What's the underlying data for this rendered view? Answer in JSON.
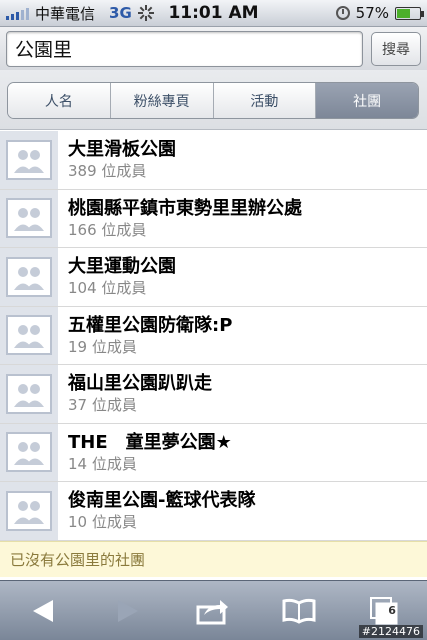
{
  "status_bar": {
    "carrier": "中華電信",
    "network": "3G",
    "time": "11:01 AM",
    "battery_percent": "57%",
    "battery_level": 0.57
  },
  "search": {
    "value": "公園里",
    "button_label": "搜尋"
  },
  "tabs": [
    {
      "label": "人名",
      "active": false
    },
    {
      "label": "粉絲專頁",
      "active": false
    },
    {
      "label": "活動",
      "active": false
    },
    {
      "label": "社團",
      "active": true
    }
  ],
  "results": [
    {
      "name": "大里滑板公園",
      "members": "389 位成員"
    },
    {
      "name": "桃園縣平鎮市東勢里里辦公處",
      "members": "166 位成員"
    },
    {
      "name": "大里運動公園",
      "members": "104 位成員"
    },
    {
      "name": "五權里公園防衛隊:P",
      "members": "19 位成員"
    },
    {
      "name": "福山里公園趴趴走",
      "members": "37 位成員"
    },
    {
      "name": "THE　童里夢公園★",
      "members": "14 位成員"
    },
    {
      "name": "俊南里公園-籃球代表隊",
      "members": "10 位成員"
    }
  ],
  "no_more_text": "已沒有公園里的社團",
  "toolbar": {
    "tab_count": "6",
    "icons": [
      "back-icon",
      "forward-icon",
      "share-icon",
      "bookmarks-icon",
      "tabs-icon"
    ]
  },
  "watermark": "#2124476"
}
